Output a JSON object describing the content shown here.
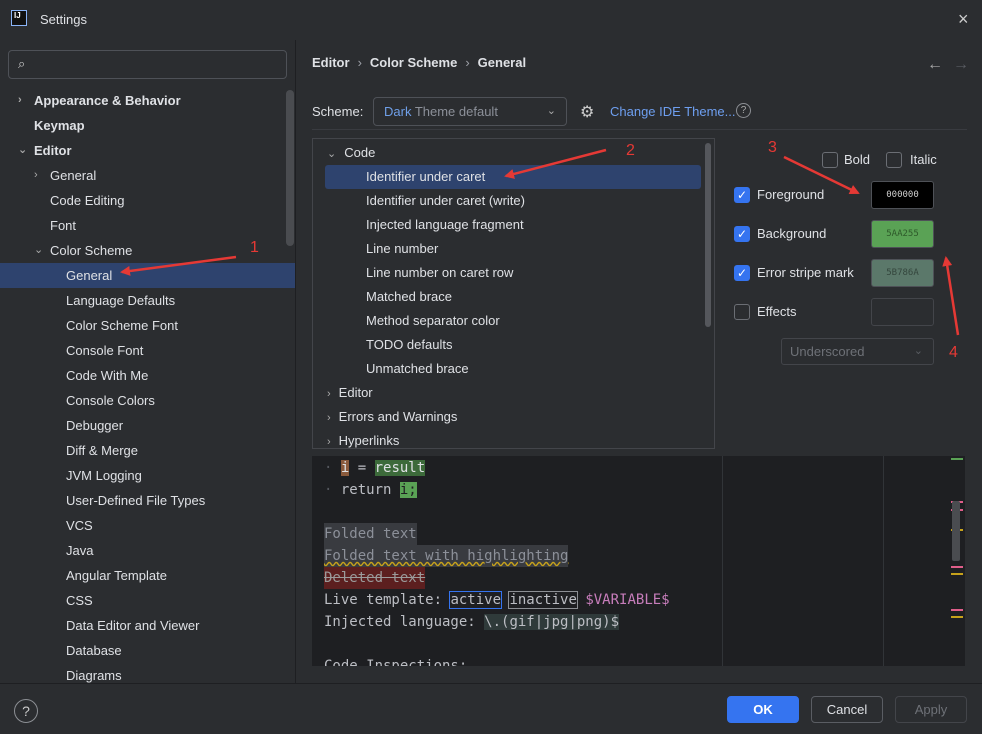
{
  "window": {
    "title": "Settings",
    "app_icon_text": "IJ"
  },
  "icons": {
    "close": "×",
    "search": "⌕",
    "chevron_right": "›",
    "chevron_down": "⌄",
    "gear": "⚙",
    "help": "?",
    "back": "←",
    "forward": "→",
    "check": "✓"
  },
  "sidebar": {
    "search_placeholder": "",
    "items": [
      {
        "label": "Appearance & Behavior",
        "bold": true,
        "chevron": "›"
      },
      {
        "label": "Keymap",
        "bold": true,
        "chevron": ""
      },
      {
        "label": "Editor",
        "bold": true,
        "chevron": "⌄"
      },
      {
        "label": "General",
        "bold": false,
        "chevron": "›"
      },
      {
        "label": "Code Editing",
        "bold": false,
        "chevron": ""
      },
      {
        "label": "Font",
        "bold": false,
        "chevron": ""
      },
      {
        "label": "Color Scheme",
        "bold": false,
        "chevron": "⌄"
      },
      {
        "label": "General",
        "bold": false,
        "chevron": "",
        "selected": true
      },
      {
        "label": "Language Defaults",
        "bold": false,
        "chevron": ""
      },
      {
        "label": "Color Scheme Font",
        "bold": false,
        "chevron": ""
      },
      {
        "label": "Console Font",
        "bold": false,
        "chevron": ""
      },
      {
        "label": "Code With Me",
        "bold": false,
        "chevron": ""
      },
      {
        "label": "Console Colors",
        "bold": false,
        "chevron": ""
      },
      {
        "label": "Debugger",
        "bold": false,
        "chevron": ""
      },
      {
        "label": "Diff & Merge",
        "bold": false,
        "chevron": ""
      },
      {
        "label": "JVM Logging",
        "bold": false,
        "chevron": ""
      },
      {
        "label": "User-Defined File Types",
        "bold": false,
        "chevron": ""
      },
      {
        "label": "VCS",
        "bold": false,
        "chevron": ""
      },
      {
        "label": "Java",
        "bold": false,
        "chevron": ""
      },
      {
        "label": "Angular Template",
        "bold": false,
        "chevron": ""
      },
      {
        "label": "CSS",
        "bold": false,
        "chevron": ""
      },
      {
        "label": "Data Editor and Viewer",
        "bold": false,
        "chevron": ""
      },
      {
        "label": "Database",
        "bold": false,
        "chevron": ""
      },
      {
        "label": "Diagrams",
        "bold": false,
        "chevron": ""
      }
    ]
  },
  "breadcrumb": [
    "Editor",
    "Color Scheme",
    "General"
  ],
  "scheme": {
    "label": "Scheme:",
    "value_accent": "Dark",
    "value_rest": " Theme default",
    "change_link": "Change IDE Theme..."
  },
  "tree": {
    "groups": [
      {
        "label": "Code",
        "expanded": true
      },
      {
        "label": "Editor",
        "expanded": false
      },
      {
        "label": "Errors and Warnings",
        "expanded": false
      },
      {
        "label": "Hyperlinks",
        "expanded": false
      }
    ],
    "code_children": [
      {
        "label": "Identifier under caret",
        "selected": true
      },
      {
        "label": "Identifier under caret (write)"
      },
      {
        "label": "Injected language fragment"
      },
      {
        "label": "Line number"
      },
      {
        "label": "Line number on caret row"
      },
      {
        "label": "Matched brace"
      },
      {
        "label": "Method separator color"
      },
      {
        "label": "TODO defaults"
      },
      {
        "label": "Unmatched brace"
      }
    ]
  },
  "options": {
    "bold_label": "Bold",
    "italic_label": "Italic",
    "foreground": {
      "label": "Foreground",
      "checked": true,
      "value": "000000",
      "color": "#000000",
      "text_color": "#d0d0d0"
    },
    "background": {
      "label": "Background",
      "checked": true,
      "value": "5AA255",
      "color": "#5aa255",
      "text_color": "#2e5a2a"
    },
    "error_stripe": {
      "label": "Error stripe mark",
      "checked": true,
      "value": "5B786A",
      "color": "#5b786a",
      "text_color": "#34463d"
    },
    "effects": {
      "label": "Effects",
      "checked": false
    },
    "effect_type": "Underscored"
  },
  "preview": {
    "line1_var": "i",
    "line1_rest": " = ",
    "line1_result": "result",
    "line2_kw": "return ",
    "line2_var": "i;",
    "folded": "Folded text",
    "folded_hl": "Folded text with highlighting",
    "deleted": "Deleted text",
    "live_label": "Live template: ",
    "live_active": "active",
    "live_inactive": "inactive",
    "live_var": "$VARIABLE$",
    "injected_label": "Injected language: ",
    "injected_value": "\\.(gif|jpg|png)$",
    "code_insp": "Code Inspections:"
  },
  "footer": {
    "ok": "OK",
    "cancel": "Cancel",
    "apply": "Apply"
  },
  "annotations": [
    "1",
    "2",
    "3",
    "4"
  ],
  "colors": {
    "accent": "#3574f0",
    "selection": "#2e436e",
    "annotation": "#e53935",
    "link": "#6e9ff0"
  }
}
